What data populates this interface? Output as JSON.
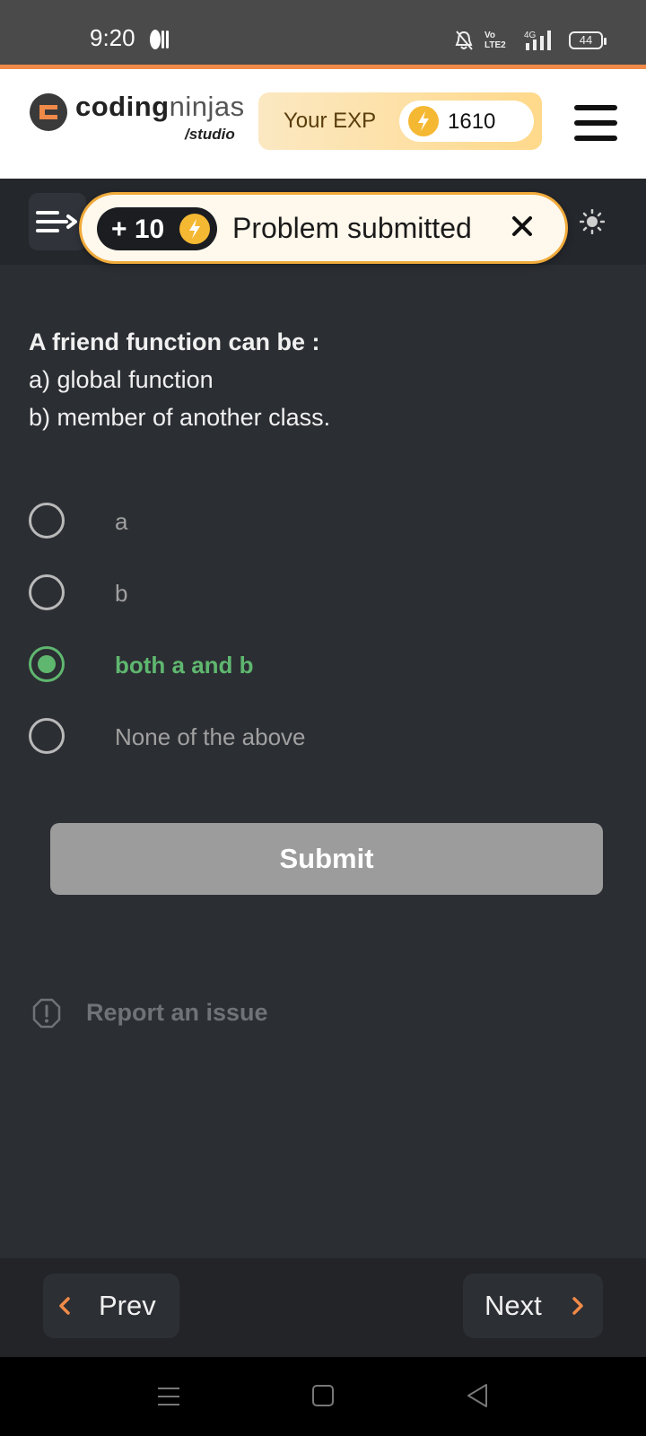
{
  "status_bar": {
    "time": "9:20",
    "network": "4G",
    "volte": "Vo LTE2",
    "battery": "44"
  },
  "header": {
    "brand_bold": "coding",
    "brand_light": "ninjas",
    "brand_sub": "/studio",
    "exp_label": "Your EXP",
    "exp_value": "1610",
    "menu_icon": "hamburger-menu-icon"
  },
  "toast": {
    "badge": "+ 10",
    "message": "Problem submitted",
    "close_icon": "close-icon"
  },
  "question": {
    "title": "A friend function can be :",
    "lines": [
      "a) global function",
      "b) member of another class."
    ]
  },
  "options": [
    {
      "label": "a",
      "selected": false
    },
    {
      "label": "b",
      "selected": false
    },
    {
      "label": "both a and b",
      "selected": true
    },
    {
      "label": "None of the above",
      "selected": false
    }
  ],
  "submit_label": "Submit",
  "report_label": "Report an issue",
  "nav": {
    "prev_label": "Prev",
    "next_label": "Next"
  },
  "colors": {
    "accent_orange": "#f08a48",
    "selected_green": "#5fb76f",
    "exp_gold": "#f5b833",
    "background": "#2b2e33"
  }
}
